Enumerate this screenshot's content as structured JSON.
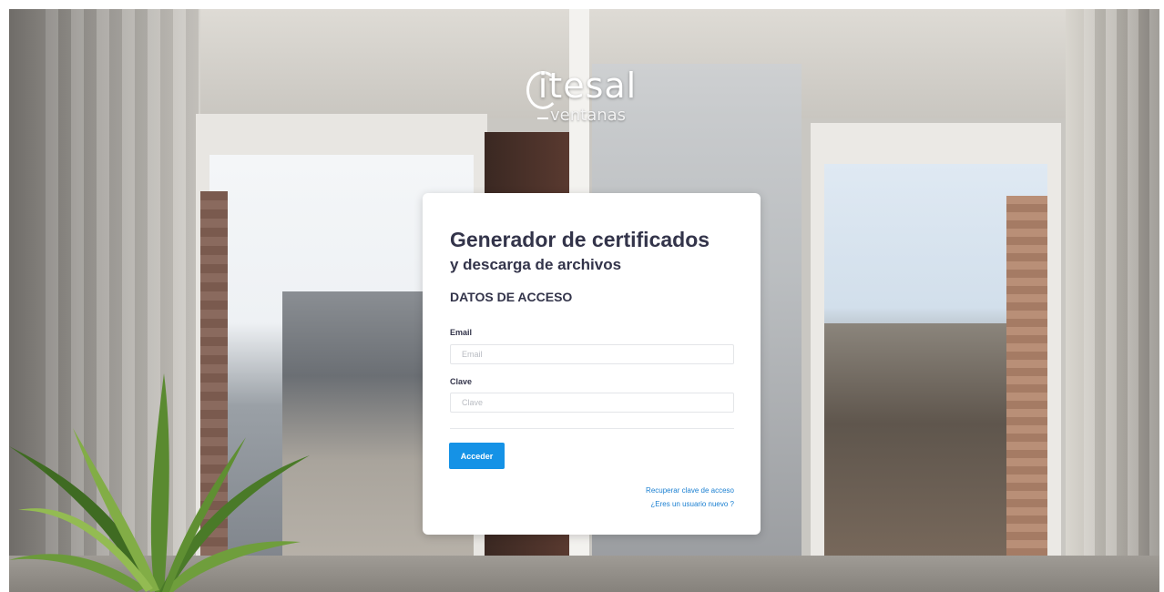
{
  "brand": {
    "logo_main": "itesal",
    "logo_sub": "ventanas"
  },
  "card": {
    "title": "Generador de certificados",
    "subtitle": "y descarga de archivos",
    "section_title": "DATOS DE ACCESO"
  },
  "form": {
    "email_label": "Email",
    "email_placeholder": "Email",
    "email_value": "",
    "password_label": "Clave",
    "password_placeholder": "Clave",
    "password_value": "",
    "submit_label": "Acceder"
  },
  "links": {
    "recover_password": "Recuperar clave de acceso",
    "new_user": "¿Eres un usuario nuevo ?"
  },
  "colors": {
    "primary": "#1592e6",
    "heading": "#33344a",
    "link": "#1a7fd1"
  }
}
